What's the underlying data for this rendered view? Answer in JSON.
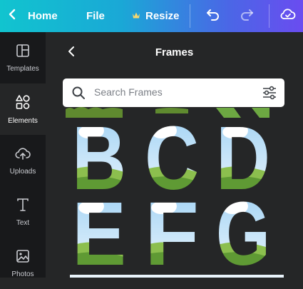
{
  "topbar": {
    "home_label": "Home",
    "file_label": "File",
    "resize_label": "Resize"
  },
  "sidebar": {
    "items": [
      {
        "label": "Templates"
      },
      {
        "label": "Elements"
      },
      {
        "label": "Uploads"
      },
      {
        "label": "Text"
      },
      {
        "label": "Photos"
      }
    ]
  },
  "panel": {
    "title": "Frames",
    "search_placeholder": "Search Frames"
  },
  "frames": [
    {
      "letter": "B"
    },
    {
      "letter": "C"
    },
    {
      "letter": "D"
    },
    {
      "letter": "E"
    },
    {
      "letter": "F"
    },
    {
      "letter": "G"
    }
  ],
  "colors": {
    "accent_gradient_start": "#11c4cf",
    "accent_gradient_end": "#6a4cf0",
    "sidebar_bg": "#18191b",
    "panel_bg": "#252627",
    "sky": "#bfe0f6",
    "grass": "#6da842"
  }
}
